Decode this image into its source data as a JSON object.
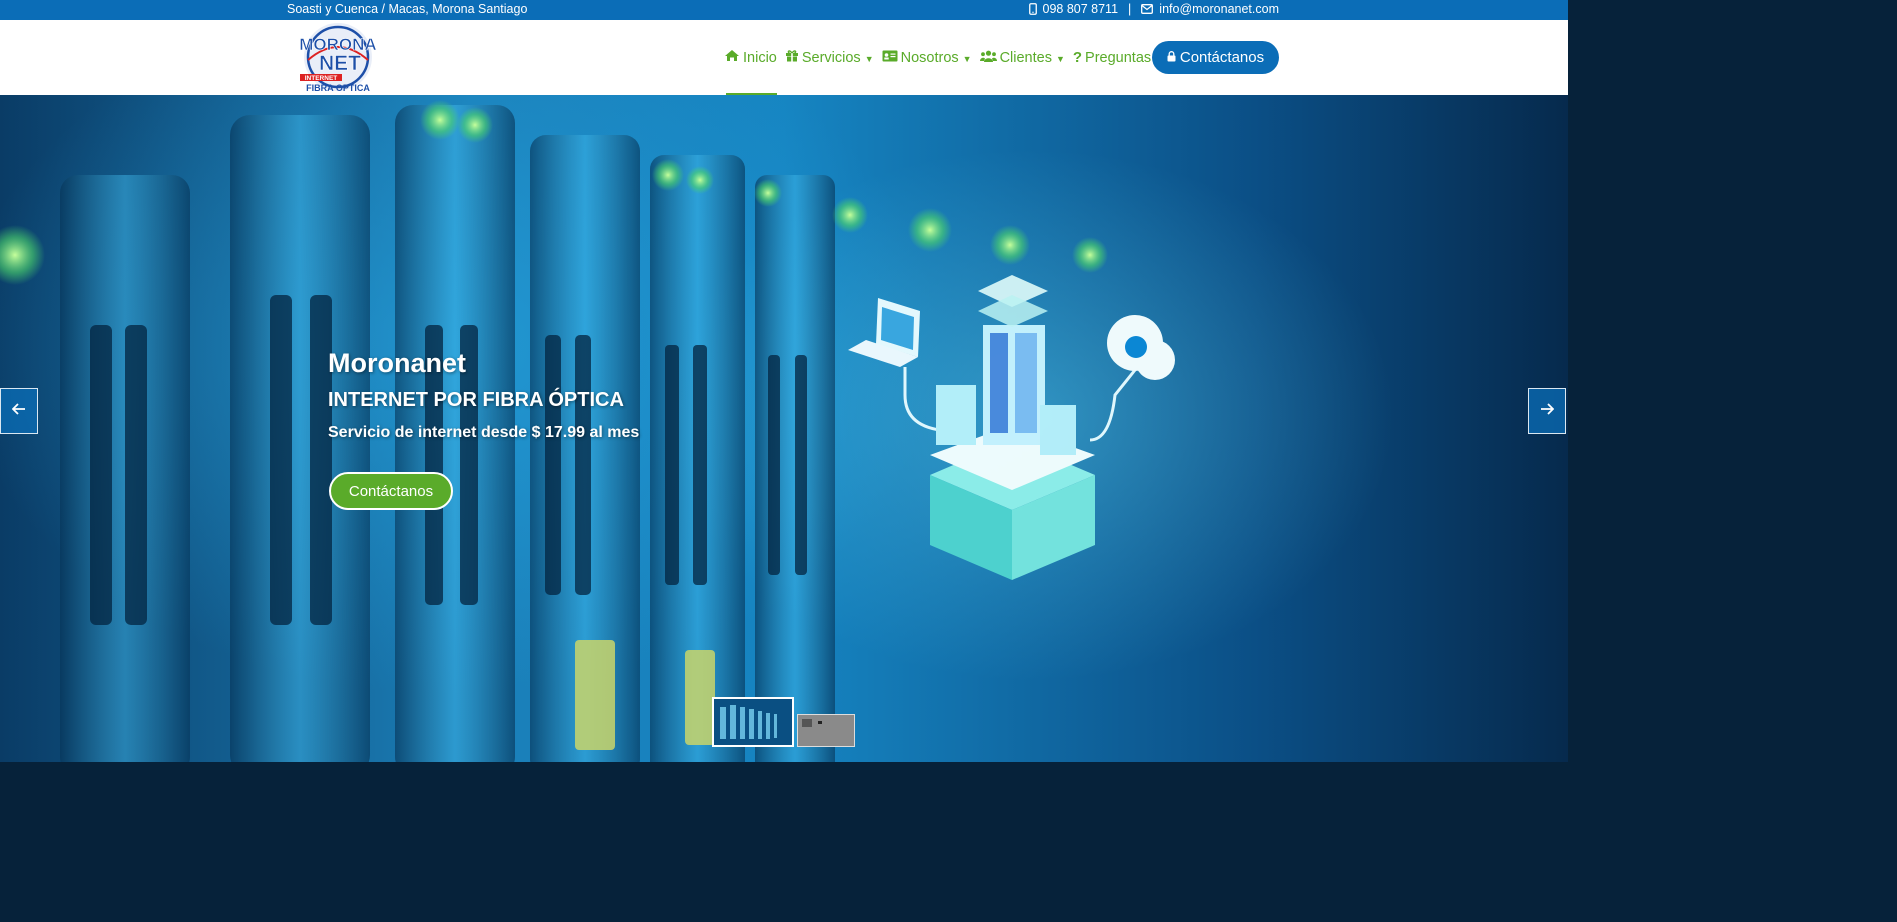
{
  "topbar": {
    "address": "Soasti y Cuenca / Macas, Morona Santiago",
    "phone": "098 807 8711",
    "separator": "|",
    "email": "info@moronanet.com"
  },
  "logo": {
    "line1": "MORONA",
    "line2": "NET",
    "tag": "INTERNET",
    "line3": "FIBRA OPTICA"
  },
  "nav": {
    "items": [
      {
        "label": "Inicio",
        "icon": "home-icon"
      },
      {
        "label": "Servicios",
        "icon": "gift-icon"
      },
      {
        "label": "Nosotros",
        "icon": "id-card-icon"
      },
      {
        "label": "Clientes",
        "icon": "users-icon"
      },
      {
        "label": "Preguntas",
        "icon": "question-icon"
      }
    ],
    "cta_label": "Contáctanos"
  },
  "hero": {
    "title": "Moronanet",
    "subtitle": "INTERNET POR FIBRA ÓPTICA",
    "price_text": "Servicio de internet desde $ 17.99 al mes",
    "button_label": "Contáctanos"
  },
  "colors": {
    "brand_blue": "#0b6db7",
    "brand_green": "#5aab2a"
  }
}
